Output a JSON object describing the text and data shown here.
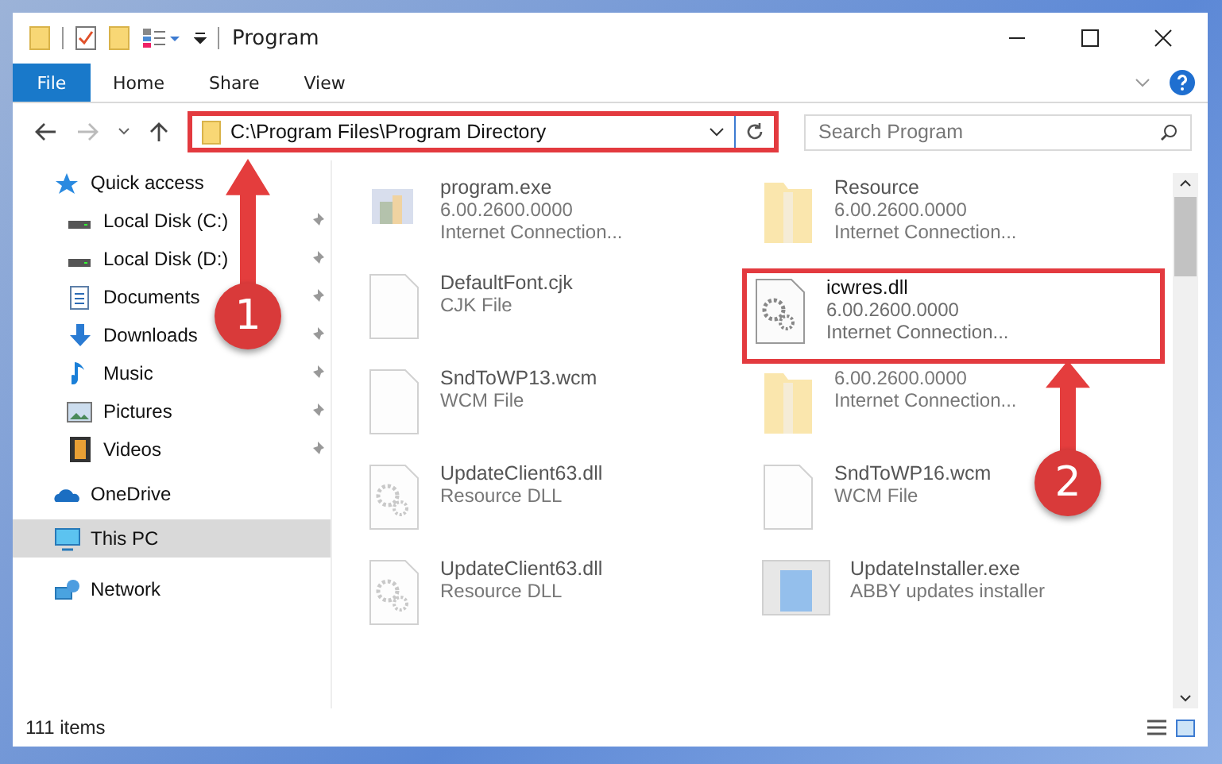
{
  "window": {
    "title": "Program"
  },
  "ribbon_tabs": [
    {
      "label": "File",
      "kind": "file"
    },
    {
      "label": "Home",
      "kind": "tab"
    },
    {
      "label": "Share",
      "kind": "tab"
    },
    {
      "label": "View",
      "kind": "tab"
    }
  ],
  "address_bar": {
    "path": "C:\\Program Files\\Program Directory",
    "highlighted": true
  },
  "search": {
    "placeholder": "Search Program"
  },
  "sidebar": {
    "items": [
      {
        "label": "Quick access",
        "selected": false,
        "children": [
          {
            "label": "Local Disk (C:)",
            "pinned": true,
            "selected": false
          },
          {
            "label": "Local Disk (D:)",
            "pinned": true,
            "selected": false
          },
          {
            "label": "Documents",
            "pinned": true,
            "selected": false
          },
          {
            "label": "Downloads",
            "pinned": true,
            "selected": false
          },
          {
            "label": "Music",
            "pinned": true,
            "selected": false
          },
          {
            "label": "Pictures",
            "pinned": true,
            "selected": false
          },
          {
            "label": "Videos",
            "pinned": true,
            "selected": false
          }
        ]
      },
      {
        "label": "OneDrive",
        "selected": false
      },
      {
        "label": "This PC",
        "selected": true
      },
      {
        "label": "Network",
        "selected": false
      }
    ]
  },
  "files": [
    {
      "name": "program.exe",
      "lines": [
        "6.00.2600.0000",
        "Internet Connection..."
      ],
      "kind": "exe",
      "blurred": true,
      "highlighted": false
    },
    {
      "name": "Resource",
      "lines": [
        "6.00.2600.0000",
        "Internet Connection..."
      ],
      "kind": "folder",
      "blurred": true,
      "highlighted": false
    },
    {
      "name": "DefaultFont.cjk",
      "lines": [
        "CJK File"
      ],
      "kind": "file",
      "blurred": true,
      "highlighted": false
    },
    {
      "name": "icwres.dll",
      "lines": [
        "6.00.2600.0000",
        "Internet Connection..."
      ],
      "kind": "dll",
      "blurred": false,
      "highlighted": true
    },
    {
      "name": "SndToWP13.wcm",
      "lines": [
        "WCM File"
      ],
      "kind": "file",
      "blurred": true,
      "highlighted": false
    },
    {
      "lines": [
        "6.00.2600.0000",
        "Internet Connection..."
      ],
      "kind": "folder",
      "blurred": true,
      "highlighted": false
    },
    {
      "name": "UpdateClient63.dll",
      "lines": [
        "Resource DLL"
      ],
      "kind": "dll",
      "blurred": true,
      "highlighted": false
    },
    {
      "name": "SndToWP16.wcm",
      "lines": [
        "WCM File"
      ],
      "kind": "file",
      "blurred": true,
      "highlighted": false
    },
    {
      "name": "UpdateClient63.dll",
      "lines": [
        "Resource DLL"
      ],
      "kind": "dll",
      "blurred": true,
      "highlighted": false
    },
    {
      "name": "UpdateInstaller.exe",
      "lines": [
        "ABBY updates installer"
      ],
      "kind": "installer",
      "blurred": true,
      "highlighted": false
    }
  ],
  "callouts": [
    {
      "label": "1"
    },
    {
      "label": "2"
    }
  ],
  "status_bar": {
    "count": "111 items"
  }
}
